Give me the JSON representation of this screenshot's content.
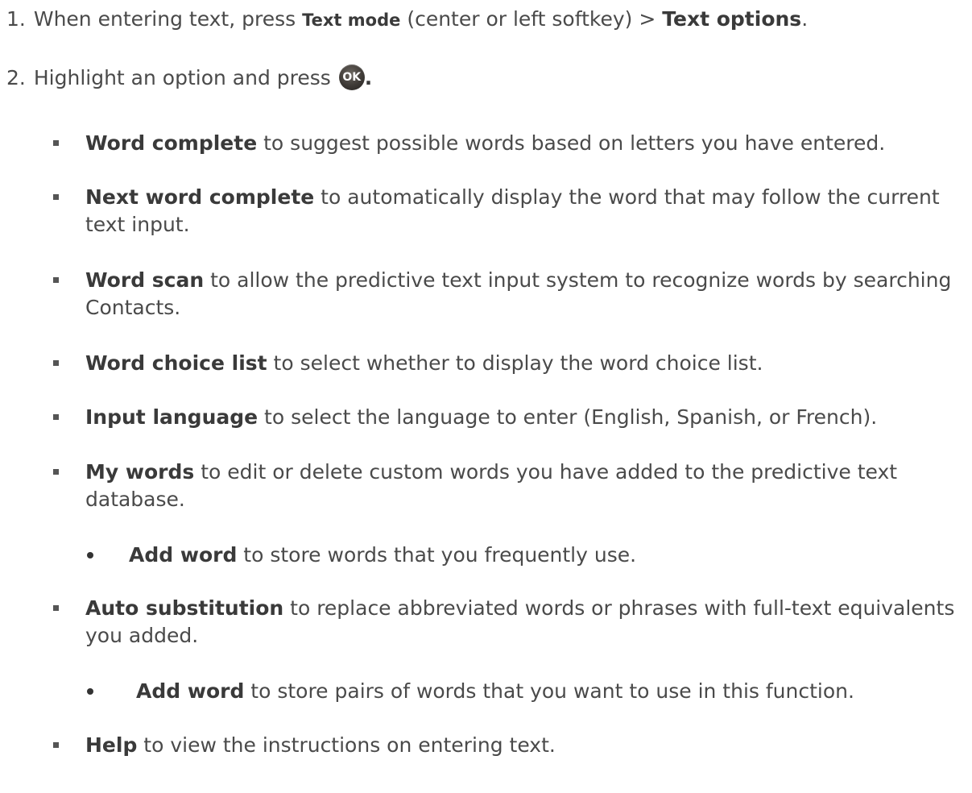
{
  "steps": [
    {
      "number": "1.",
      "pre": "When entering text, press ",
      "key": "Text mode",
      "mid": " (center or left softkey) > ",
      "bold": "Text options",
      "post": "."
    },
    {
      "number": "2.",
      "pre": "Highlight an option and press ",
      "ok_label": "OK",
      "post": "."
    }
  ],
  "options": [
    {
      "title": "Word complete",
      "desc": " to suggest possible words based on letters you have entered."
    },
    {
      "title": "Next word complete",
      "desc": " to automatically display the word that may follow the current text input."
    },
    {
      "title": "Word scan",
      "desc": " to allow the predictive text input system to recognize words by searching Contacts."
    },
    {
      "title": "Word choice list",
      "desc": " to select whether to display the word choice list."
    },
    {
      "title": "Input language",
      "desc": " to select the language to enter (English, Spanish, or French)."
    },
    {
      "title": "My words",
      "desc": " to edit or delete custom words you have added to the predictive text database."
    },
    {
      "title": "Add word",
      "desc": " to store words that you frequently use."
    },
    {
      "title": "Auto substitution",
      "desc": " to replace abbreviated words or phrases with full-text equivalents you added."
    },
    {
      "title": "Add word",
      "desc": " to store pairs of words that you want to use in this function."
    },
    {
      "title": "Help",
      "desc": " to view the instructions on entering text."
    }
  ]
}
